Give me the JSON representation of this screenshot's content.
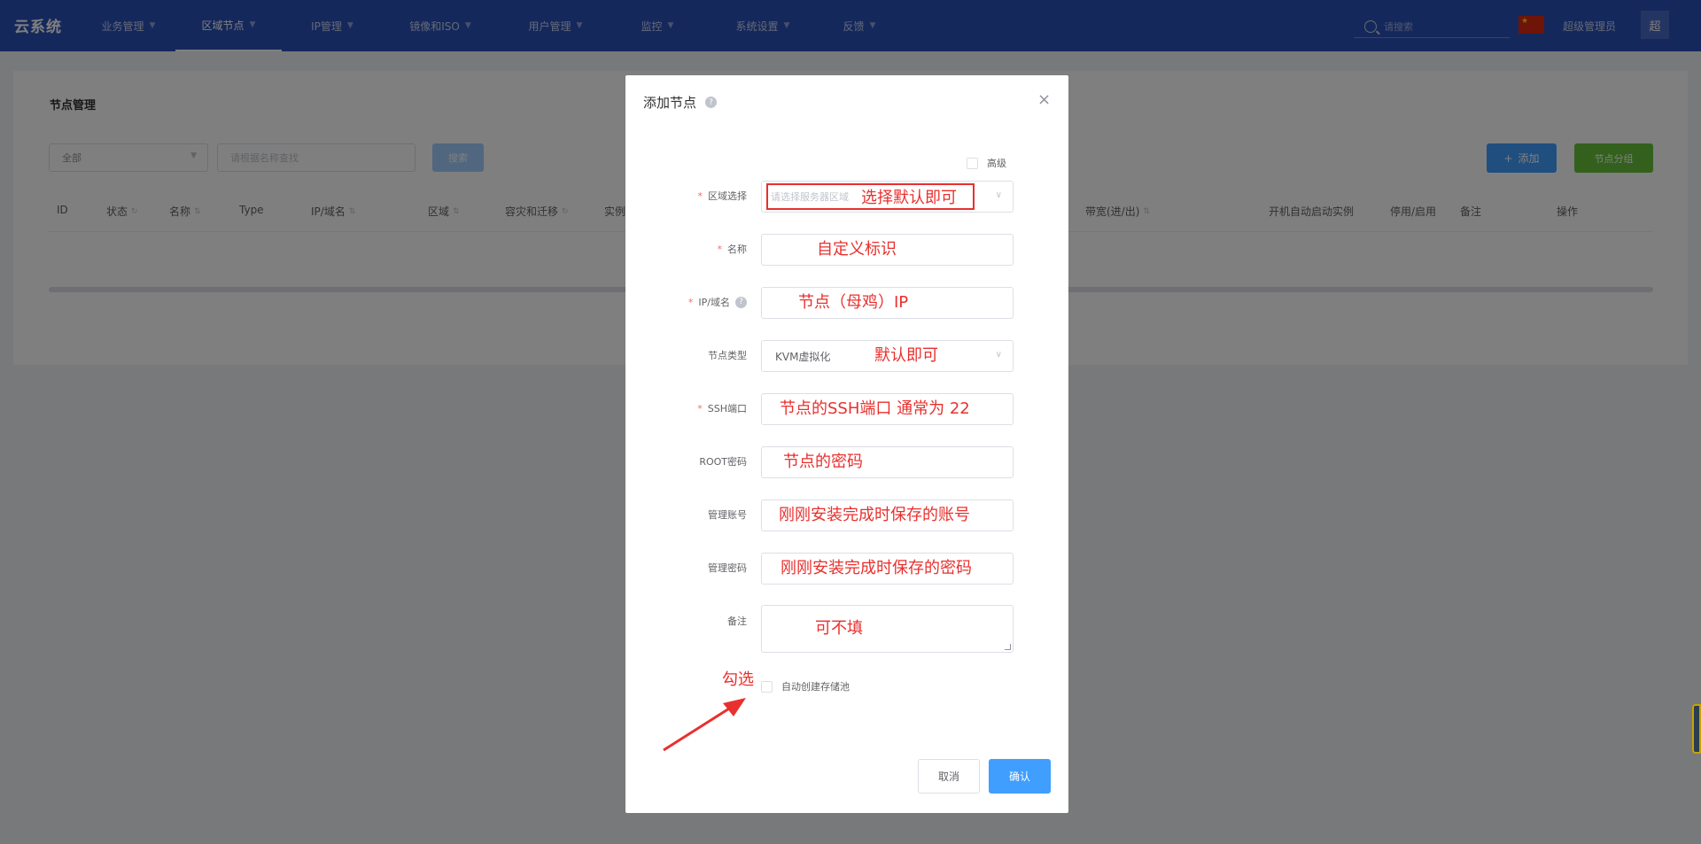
{
  "app": {
    "logo": "云系统"
  },
  "nav": [
    {
      "label": "业务管理",
      "active": false
    },
    {
      "label": "区域节点",
      "active": true
    },
    {
      "label": "IP管理",
      "active": false
    },
    {
      "label": "镜像和ISO",
      "active": false
    },
    {
      "label": "用户管理",
      "active": false
    },
    {
      "label": "监控",
      "active": false
    },
    {
      "label": "系统设置",
      "active": false
    },
    {
      "label": "反馈",
      "active": false
    }
  ],
  "header": {
    "search_placeholder": "请搜索",
    "user_name": "超级管理员",
    "avatar_text": "超",
    "flag_icon": "china-flag-icon"
  },
  "page": {
    "title": "节点管理",
    "region_filter": "全部",
    "keyword_placeholder": "请根据名称查找",
    "search_button": "搜索",
    "add_button": "添加",
    "group_button": "节点分组",
    "columns": [
      {
        "label": "ID",
        "sort": false
      },
      {
        "label": "状态",
        "sort": true
      },
      {
        "label": "名称",
        "sort": true
      },
      {
        "label": "Type",
        "sort": false
      },
      {
        "label": "IP/域名",
        "sort": true
      },
      {
        "label": "区域",
        "sort": true
      },
      {
        "label": "容灾和迁移",
        "sort": true
      },
      {
        "label": "实例",
        "sort": false
      },
      {
        "label": "带宽(进/出)",
        "sort": true
      },
      {
        "label": "开机自动启动实例",
        "sort": false
      },
      {
        "label": "停用/启用",
        "sort": false
      },
      {
        "label": "备注",
        "sort": false
      },
      {
        "label": "操作",
        "sort": false
      }
    ]
  },
  "dialog": {
    "title": "添加节点",
    "advanced_label": "高级",
    "fields": [
      {
        "key": "region",
        "label": "区域选择",
        "required": true,
        "value": "",
        "placeholder": "请选择服务器区域",
        "type": "select"
      },
      {
        "key": "name",
        "label": "名称",
        "required": true,
        "value": "",
        "placeholder": "",
        "type": "input"
      },
      {
        "key": "ip",
        "label": "IP/域名",
        "required": true,
        "value": "",
        "placeholder": "",
        "type": "input"
      },
      {
        "key": "node_type",
        "label": "节点类型",
        "required": false,
        "value": "KVM虚拟化",
        "placeholder": "",
        "type": "select"
      },
      {
        "key": "ssh_port",
        "label": "SSH端口",
        "required": true,
        "value": "",
        "placeholder": "",
        "type": "input"
      },
      {
        "key": "root_password",
        "label": "ROOT密码",
        "required": false,
        "value": "",
        "placeholder": "",
        "type": "input"
      },
      {
        "key": "ctrl_account",
        "label": "管理账号",
        "required": false,
        "value": "",
        "placeholder": "",
        "type": "input"
      },
      {
        "key": "ctrl_password",
        "label": "管理密码",
        "required": false,
        "value": "",
        "placeholder": "",
        "type": "input"
      }
    ],
    "remark_label": "备注",
    "auto_create_label": "自动创建存储池",
    "cancel_button": "取消",
    "confirm_button": "确认"
  },
  "annotations": {
    "region": "选择默认即可",
    "name": "自定义标识",
    "ip": "节点（母鸡）IP",
    "node_type": "默认即可",
    "ssh_port": "节点的SSH端口 通常为 22",
    "root_password": "节点的密码",
    "ctrl_account": "刚刚安装完成时保存的账号",
    "ctrl_password": "刚刚安装完成时保存的密码",
    "remark": "可不填",
    "auto_create": "勾选"
  },
  "colors": {
    "topbar": "#2b51b8",
    "primary": "#409eff",
    "success": "#67c23a",
    "annotation": "#e8302e"
  }
}
